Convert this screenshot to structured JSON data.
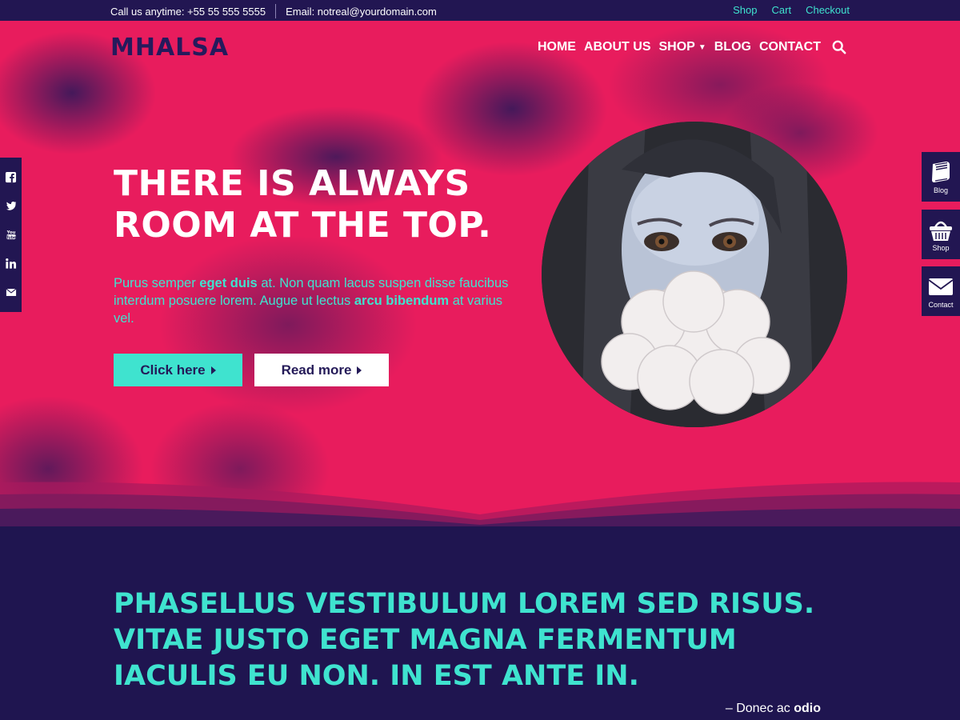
{
  "topbar": {
    "phone": "Call us anytime: +55 55 555 5555",
    "email": "Email: notreal@yourdomain.com",
    "links": [
      "Shop",
      "Cart",
      "Checkout"
    ]
  },
  "header": {
    "logo": "MHALSA",
    "nav": [
      "HOME",
      "ABOUT US",
      "SHOP",
      "BLOG",
      "CONTACT"
    ]
  },
  "hero": {
    "headline_line1": "There is always",
    "headline_line2": "room at the top.",
    "lede_1": "Purus semper ",
    "lede_2": "eget duis",
    "lede_3": " at. Non quam lacus suspen disse faucibus interdum posuere lorem. Augue ut lectus ",
    "lede_4": "arcu bibendum",
    "lede_5": " at varius vel.",
    "primary_button": "Click here",
    "secondary_button": "Read more"
  },
  "social": [
    "facebook-icon",
    "twitter-icon",
    "youtube-icon",
    "linkedin-icon",
    "email-icon"
  ],
  "widgets": {
    "blog": "Blog",
    "shop": "Shop",
    "contact": "Contact"
  },
  "quote": {
    "text": "Phasellus vestibulum lorem sed risus. Vitae justo eget magna fermentum iaculis eu non. In est ante in.",
    "cite_prefix": "– Donec ac ",
    "cite_bold": "odio"
  },
  "colors": {
    "accent": "#3fe3cf",
    "hero": "#e81c5d",
    "dark": "#221652"
  }
}
